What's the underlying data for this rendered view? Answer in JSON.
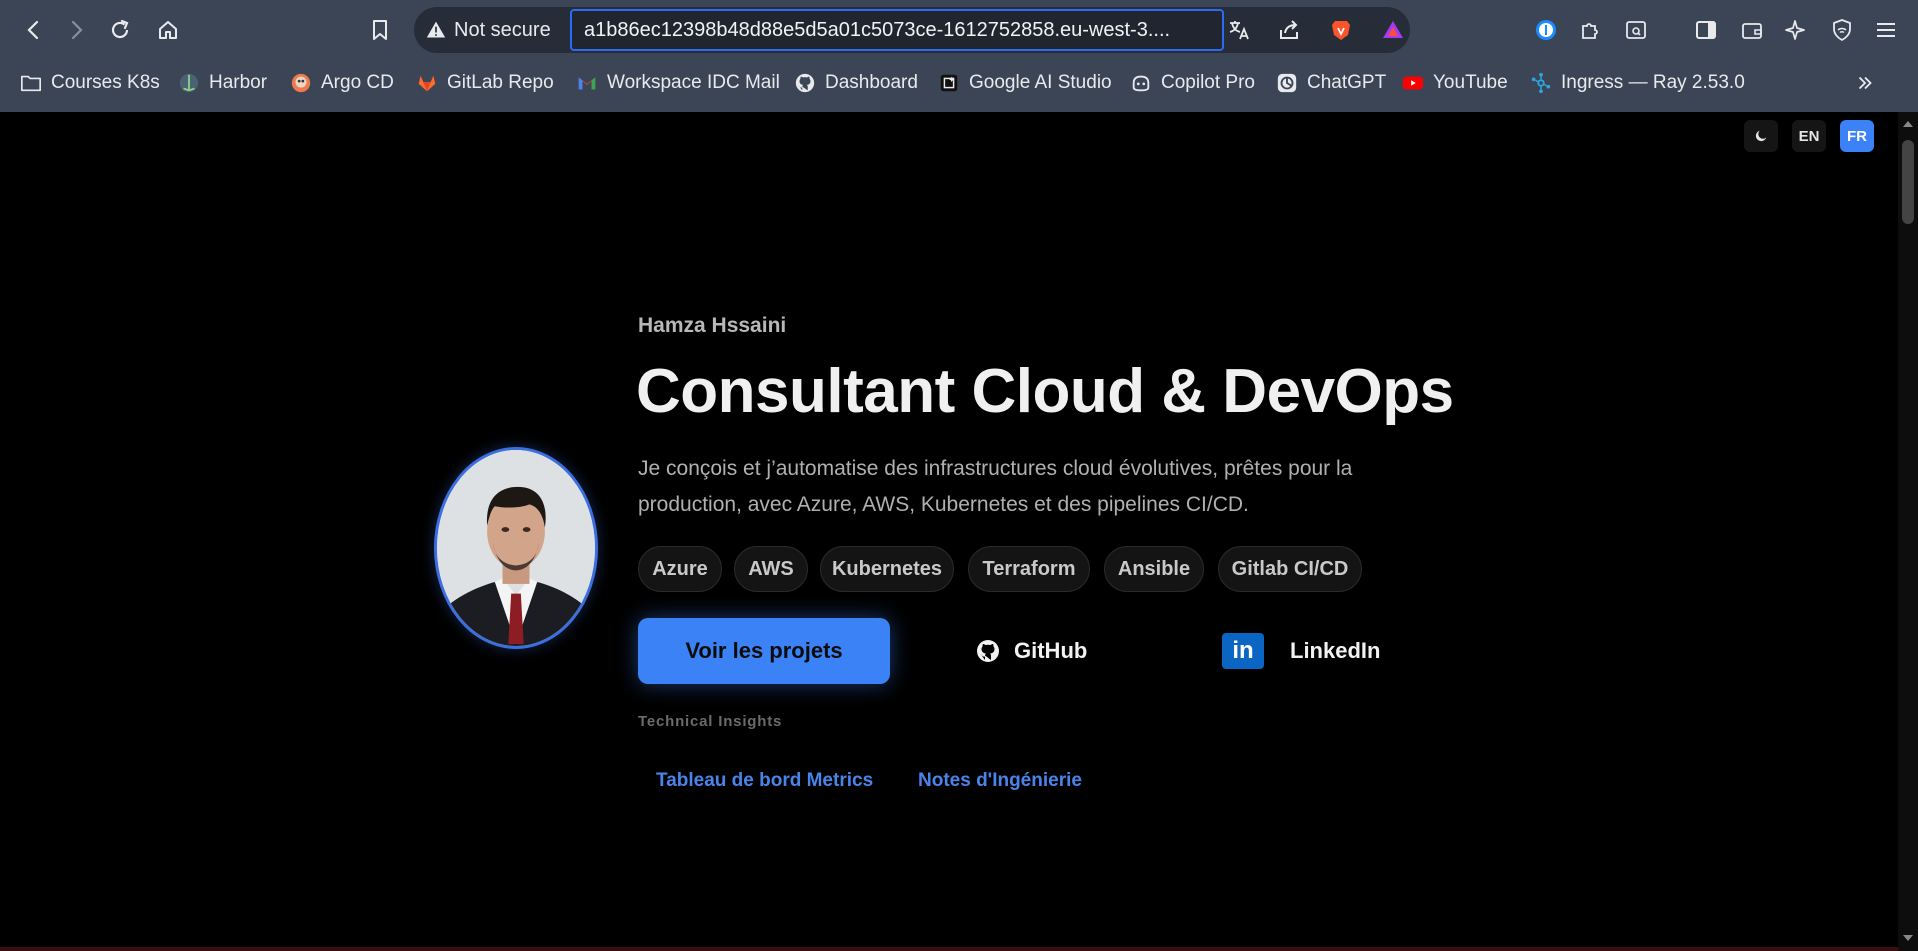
{
  "browser": {
    "security_label": "Not secure",
    "url": "a1b86ec12398b48d88e5d5a01c5073ce-1612752858.eu-west-3....",
    "bookmarks": [
      {
        "label": "Courses K8s",
        "icon": "folder-icon"
      },
      {
        "label": "Harbor",
        "icon": "harbor-icon"
      },
      {
        "label": "Argo CD",
        "icon": "argocd-icon"
      },
      {
        "label": "GitLab Repo",
        "icon": "gitlab-icon"
      },
      {
        "label": "Workspace IDC Mail",
        "icon": "gmail-icon"
      },
      {
        "label": "Dashboard",
        "icon": "github-icon"
      },
      {
        "label": "Google AI Studio",
        "icon": "ai-studio-icon"
      },
      {
        "label": "Copilot Pro",
        "icon": "copilot-icon"
      },
      {
        "label": "ChatGPT",
        "icon": "chatgpt-icon"
      },
      {
        "label": "YouTube",
        "icon": "youtube-icon"
      },
      {
        "label": "Ingress — Ray 2.53.0",
        "icon": "ray-icon"
      }
    ],
    "colors": {
      "chrome": "#3c4555",
      "omnibox": "#262c38",
      "focus": "#2b6bf0"
    }
  },
  "page": {
    "controls": {
      "theme_icon": "moon-icon",
      "lang_en": "EN",
      "lang_fr": "FR",
      "active_lang": "FR"
    },
    "profile": {
      "name": "Hamza Hssaini",
      "headline": "Consultant Cloud & DevOps",
      "description": "Je conçois et j’automatise des infrastructures cloud évolutives, prêtes pour la production, avec Azure, AWS, Kubernetes et des pipelines CI/CD."
    },
    "tags": [
      "Azure",
      "AWS",
      "Kubernetes",
      "Terraform",
      "Ansible",
      "Gitlab CI/CD"
    ],
    "actions": {
      "primary": "Voir les projets",
      "github": "GitHub",
      "linkedin": "LinkedIn",
      "linkedin_logo": "in"
    },
    "insights": {
      "label": "Technical Insights",
      "links": [
        "Tableau de bord Metrics",
        "Notes d'Ingénierie"
      ]
    },
    "colors": {
      "accent": "#3b82f6",
      "background": "#000000"
    }
  }
}
